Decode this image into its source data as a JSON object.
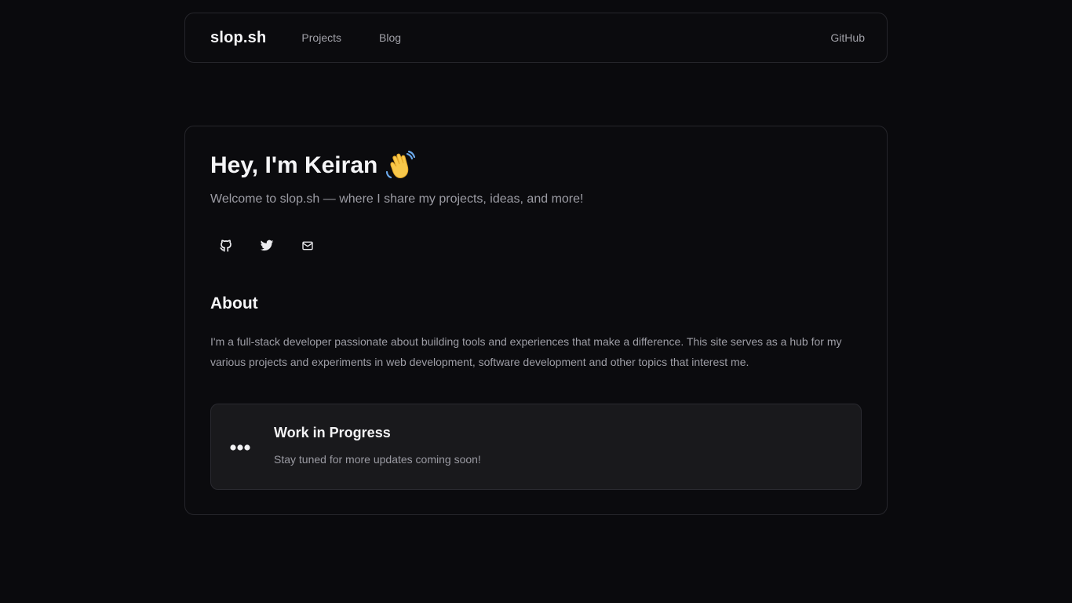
{
  "nav": {
    "brand": "slop.sh",
    "links": [
      "Projects",
      "Blog"
    ],
    "right_link": "GitHub"
  },
  "hero": {
    "title": "Hey, I'm Keiran",
    "emoji_icon": "waving-hand-icon",
    "subtitle": "Welcome to slop.sh — where I share my projects, ideas, and more!"
  },
  "socials": [
    {
      "icon": "github-icon"
    },
    {
      "icon": "twitter-icon"
    },
    {
      "icon": "mail-icon"
    }
  ],
  "about": {
    "heading": "About",
    "text": "I'm a full-stack developer passionate about building tools and experiences that make a difference. This site serves as a hub for my various projects and experiments in web development, software development and other topics that interest me."
  },
  "wip": {
    "icon": "more-dots-icon",
    "title": "Work in Progress",
    "text": "Stay tuned for more updates coming soon!"
  },
  "colors": {
    "background": "#0a0a0d",
    "border": "#26262b",
    "muted_text": "#9e9ea6",
    "card_bg": "#19191c"
  }
}
